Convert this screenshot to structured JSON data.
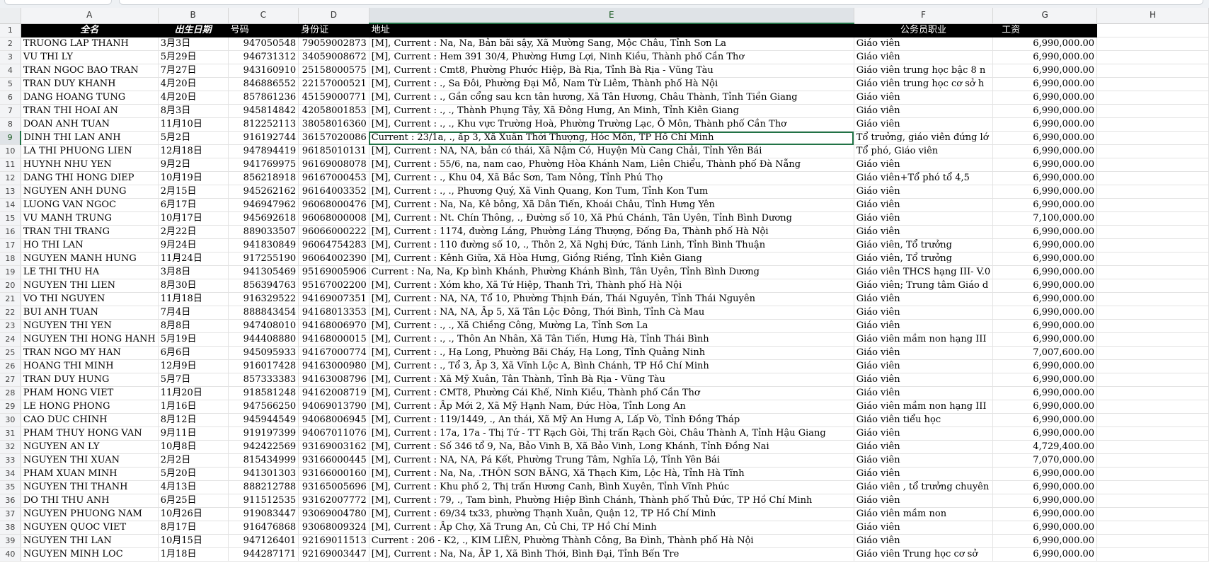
{
  "columns": [
    "A",
    "B",
    "C",
    "D",
    "E",
    "F",
    "G",
    "H"
  ],
  "header": {
    "name": "全名",
    "dob": "出生日期",
    "phone": "号码",
    "id": "身份证",
    "address": "地址",
    "job": "公务员职业",
    "salary": "工资"
  },
  "rows": [
    {
      "n": "2",
      "name": "TRUONG LAP THANH",
      "dob": "3月3日",
      "phone": "947050548",
      "id": "79059002873",
      "address": "[M], Current : Na, Na, Bản bãi sậy, Xã Mường Sang, Mộc Châu, Tỉnh Sơn La",
      "job": "Giáo viên",
      "salary": "6,990,000.00"
    },
    {
      "n": "3",
      "name": "VU THI LY",
      "dob": "5月29日",
      "phone": "946731312",
      "id": "34059008672",
      "address": "[M], Current : Hem 391 30/4, Phường Hưng Lợi, Ninh Kiều, Thành phố Cần Thơ",
      "job": "Giáo viên",
      "salary": "6,990,000.00"
    },
    {
      "n": "4",
      "name": "TRAN NGOC BAO TRAN",
      "dob": "7月27日",
      "phone": "943160910",
      "id": "25158000575",
      "address": "[M], Current : Cmt8, Phường Phước Hiệp, Bà Rịa, Tỉnh Bà Rịa - Vũng Tàu",
      "job": "Giáo viên trung học bậc 8 n",
      "salary": "6,990,000.00"
    },
    {
      "n": "5",
      "name": "TRAN DUY KHANH",
      "dob": "4月20日",
      "phone": "846886552",
      "id": "22157000521",
      "address": "[M], Current : ., Sa Đôi, Phường Đại Mỗ, Nam Từ Liêm, Thành phố Hà Nội",
      "job": "Giáo viên trung học cơ sở h",
      "salary": "6,990,000.00"
    },
    {
      "n": "6",
      "name": "DANG HOANG TUNG",
      "dob": "4月20日",
      "phone": "857861236",
      "id": "45159000771",
      "address": "[M], Current : ., Gần cổng sau kcn tân hương, Xã Tân Hương, Châu Thành, Tỉnh Tiền Giang",
      "job": "Giáo viên",
      "salary": "6,990,000.00"
    },
    {
      "n": "7",
      "name": "TRAN THI HOAI AN",
      "dob": "8月3日",
      "phone": "945814842",
      "id": "42058001853",
      "address": "[M], Current : ., ., Thành Phụng Tây, Xã Đông Hưng, An Minh, Tỉnh Kiên Giang",
      "job": "Giáo viên",
      "salary": "6,990,000.00"
    },
    {
      "n": "8",
      "name": "DOAN ANH TUAN",
      "dob": "11月10日",
      "phone": "812252113",
      "id": "38058016360",
      "address": "[M], Current : ., ., Khu vực Trường Hoà, Phường Trường Lạc, Ô Môn, Thành phố Cần Thơ",
      "job": "Giáo viên",
      "salary": "6,990,000.00"
    },
    {
      "n": "9",
      "name": "DINH THI LAN ANH",
      "dob": "5月2日",
      "phone": "916192744",
      "id": "36157020086",
      "address": "Current : 23/1a, ., ấp 3, Xã Xuân Thới Thượng, Hóc Môn, TP Hồ Chí Minh",
      "job": "Tổ trưởng, giáo viên đứng lớ",
      "salary": "6,990,000.00"
    },
    {
      "n": "10",
      "name": "LA THI PHUONG LIEN",
      "dob": "12月18日",
      "phone": "947894419",
      "id": "96185010131",
      "address": "[M], Current : NA, NA, bản có thái, Xã Nậm Có, Huyện Mù Cang Chải, Tỉnh Yên Bái",
      "job": "Tổ phó, Giáo viên",
      "salary": "6,990,000.00"
    },
    {
      "n": "11",
      "name": "HUYNH NHU YEN",
      "dob": "9月2日",
      "phone": "941769975",
      "id": "96169008078",
      "address": "[M], Current : 55/6, na, nam cao, Phường Hòa Khánh Nam, Liên Chiểu, Thành phố Đà Nẵng",
      "job": "Giáo viên",
      "salary": "6,990,000.00"
    },
    {
      "n": "12",
      "name": "DANG THI HONG DIEP",
      "dob": "10月19日",
      "phone": "856218918",
      "id": "96167000453",
      "address": "[M], Current : ., Khu 04, Xã Bắc Sơn, Tam Nông, Tỉnh Phú Thọ",
      "job": "Giáo viên+Tổ phó tổ 4,5",
      "salary": "6,990,000.00"
    },
    {
      "n": "13",
      "name": "NGUYEN ANH DUNG",
      "dob": "2月15日",
      "phone": "945262162",
      "id": "96164003352",
      "address": "[M], Current : ., ., Phương Quý, Xã Vinh Quang, Kon Tum, Tỉnh Kon Tum",
      "job": "Giáo viên",
      "salary": "6,990,000.00"
    },
    {
      "n": "14",
      "name": "LUONG VAN NGOC",
      "dob": "6月17日",
      "phone": "946947962",
      "id": "96068000476",
      "address": "[M], Current : Na, Na, Kê bông, Xã Dân Tiến, Khoái Châu, Tỉnh Hưng Yên",
      "job": "Giáo viên",
      "salary": "6,990,000.00"
    },
    {
      "n": "15",
      "name": "VU MANH TRUNG",
      "dob": "10月17日",
      "phone": "945692618",
      "id": "96068000008",
      "address": "[M], Current : Nt. Chín Thông, ., Đường số 10, Xã Phú Chánh, Tân Uyên, Tỉnh Bình Dương",
      "job": "Giáo viên",
      "salary": "7,100,000.00"
    },
    {
      "n": "16",
      "name": "TRAN THI TRANG",
      "dob": "2月22日",
      "phone": "889033507",
      "id": "96066000222",
      "address": "[M], Current : 1174, đường Láng, Phường Láng Thượng, Đống Đa, Thành phố Hà Nội",
      "job": "Giáo viên",
      "salary": "6,990,000.00"
    },
    {
      "n": "17",
      "name": "HO THI LAN",
      "dob": "9月24日",
      "phone": "941830849",
      "id": "96064754283",
      "address": "[M], Current : 110 đường  số  10, ., Thôn  2, Xã Nghị Đức, Tánh Linh, Tỉnh Bình Thuận",
      "job": "Giáo viên, Tổ trưởng",
      "salary": "6,990,000.00"
    },
    {
      "n": "18",
      "name": "NGUYEN MANH HUNG",
      "dob": "11月24日",
      "phone": "917255190",
      "id": "96064002390",
      "address": "[M], Current : Kênh Giữa, Xã Hòa Hưng, Giồng Riềng, Tỉnh Kiên Giang",
      "job": "Giáo viên, Tổ trưởng",
      "salary": "6,990,000.00"
    },
    {
      "n": "19",
      "name": "LE THI THU HA",
      "dob": "3月8日",
      "phone": "941305469",
      "id": "95169005906",
      "address": "Current : Na, Na, Kp bình Khánh, Phường Khánh Bình, Tân Uyên, Tỉnh Bình Dương",
      "job": "Giáo viên THCS hạng III- V.0",
      "salary": "6,990,000.00"
    },
    {
      "n": "20",
      "name": "NGUYEN THI LIEN",
      "dob": "8月30日",
      "phone": "856394763",
      "id": "95167002200",
      "address": "[M], Current : Xóm kho, Xã Tứ Hiệp, Thanh Trì, Thành phố Hà Nội",
      "job": "Giáo viên; Trung tâm Giáo d",
      "salary": "6,990,000.00"
    },
    {
      "n": "21",
      "name": "VO THI NGUYEN",
      "dob": "11月18日",
      "phone": "916329522",
      "id": "94169007351",
      "address": "[M], Current : NA, NA, Tổ 10, Phường Thịnh Đán, Thái Nguyên, Tỉnh Thái Nguyên",
      "job": "Giáo viên",
      "salary": "6,990,000.00"
    },
    {
      "n": "22",
      "name": "BUI ANH TUAN",
      "dob": "7月4日",
      "phone": "888843454",
      "id": "94168013353",
      "address": "[M], Current : NA, NA, Ấp 5, Xã Tân Lộc Đông, Thới Bình, Tỉnh Cà Mau",
      "job": "Giáo viên",
      "salary": "6,990,000.00"
    },
    {
      "n": "23",
      "name": "NGUYEN THI YEN",
      "dob": "8月8日",
      "phone": "947408010",
      "id": "94168006970",
      "address": "[M], Current : ., ., Xã Chiềng Công, Mường La, Tỉnh Sơn La",
      "job": "Giáo viên",
      "salary": "6,990,000.00"
    },
    {
      "n": "24",
      "name": "NGUYEN THI HONG HANH",
      "dob": "5月19日",
      "phone": "944408880",
      "id": "94168000015",
      "address": "[M], Current : ., ., Thôn An Nhân, Xã Tân Tiến, Hưng Hà, Tỉnh Thái Bình",
      "job": "Giáo viên mầm non hạng III",
      "salary": "6,990,000.00"
    },
    {
      "n": "25",
      "name": "TRAN NGO MY HAN",
      "dob": "6月6日",
      "phone": "945095933",
      "id": "94167000774",
      "address": "[M], Current : ., Hạ Long, Phường Bãi Cháy, Hạ Long, Tỉnh Quảng Ninh",
      "job": "Giáo viên",
      "salary": "7,007,600.00"
    },
    {
      "n": "26",
      "name": "HOANG THI MINH",
      "dob": "12月9日",
      "phone": "916017428",
      "id": "94163000980",
      "address": "[M], Current : ., Tổ 3, Ấp 3, Xã Vĩnh Lộc A, Bình Chánh, TP Hồ Chí Minh",
      "job": "Giáo viên",
      "salary": "6,990,000.00"
    },
    {
      "n": "27",
      "name": "TRAN DUY HUNG",
      "dob": "5月7日",
      "phone": "857333383",
      "id": "94163008796",
      "address": "[M], Current : Xã Mỹ Xuân, Tân Thành, Tỉnh Bà Rịa - Vũng Tàu",
      "job": "Giáo viên",
      "salary": "6,990,000.00"
    },
    {
      "n": "28",
      "name": "PHAM HONG VIET",
      "dob": "11月20日",
      "phone": "918581248",
      "id": "94162008719",
      "address": "[M], Current : CMT8, Phường Cái Khế, Ninh Kiều, Thành phố Cần Thơ",
      "job": "Giáo viên",
      "salary": "6,990,000.00"
    },
    {
      "n": "29",
      "name": "LE HONG PHONG",
      "dob": "1月16日",
      "phone": "947566250",
      "id": "94069013790",
      "address": "[M], Current : Ấp Mới 2, Xã Mỹ Hạnh Nam, Đức Hòa, Tỉnh Long An",
      "job": "Giáo viên mầm non hạng III",
      "salary": "6,990,000.00"
    },
    {
      "n": "30",
      "name": "CAO DUC CHINH",
      "dob": "8月12日",
      "phone": "945944549",
      "id": "94068006945",
      "address": "[M], Current : 119/1449, ., An thái, Xã Mỹ An Hưng A, Lấp Vò, Tỉnh Đồng Tháp",
      "job": "Giáo viên tiểu học",
      "salary": "6,990,000.00"
    },
    {
      "n": "31",
      "name": "PHAM THUY HONG VAN",
      "dob": "9月11日",
      "phone": "919197399",
      "id": "94067011076",
      "address": "[M], Current : 17a, 17a - Thị Tứ - TT Rạch Gòi, Thị trấn Rạch Gòi, Châu Thành A, Tỉnh Hậu Giang",
      "job": "Giáo viên",
      "salary": "6,990,000.00"
    },
    {
      "n": "32",
      "name": "NGUYEN AN LY",
      "dob": "10月8日",
      "phone": "942422569",
      "id": "93169003162",
      "address": "[M], Current : Số 346 tổ 9, Na, Bảo Vinh B, Xã Bảo Vinh, Long Khánh, Tỉnh Đồng Nai",
      "job": "Giáo viên",
      "salary": "4,729,400.00"
    },
    {
      "n": "33",
      "name": "NGUYEN THI XUAN",
      "dob": "2月2日",
      "phone": "815434999",
      "id": "93166000445",
      "address": "[M], Current : NA, NA, Pá Kết, Phường Trung Tâm, Nghĩa Lộ, Tỉnh Yên Bái",
      "job": "Giáo viên",
      "salary": "7,070,000.00"
    },
    {
      "n": "34",
      "name": "PHAM XUAN MINH",
      "dob": "5月20日",
      "phone": "941301303",
      "id": "93166000160",
      "address": "[M], Current : Na, Na, .THÔN SƠN BẰNG, Xã Thạch Kim, Lộc Hà, Tỉnh Hà Tĩnh",
      "job": "Giáo viên",
      "salary": "6,990,000.00"
    },
    {
      "n": "35",
      "name": "NGUYEN THI THANH",
      "dob": "4月13日",
      "phone": "888212788",
      "id": "93165005696",
      "address": "[M], Current : Khu phố 2, Thị trấn Hương Canh, Bình Xuyên, Tỉnh Vĩnh Phúc",
      "job": "Giáo viên , tổ trưởng chuyên",
      "salary": "6,990,000.00"
    },
    {
      "n": "36",
      "name": "DO THI THU ANH",
      "dob": "6月25日",
      "phone": "911512535",
      "id": "93162007772",
      "address": "[M], Current : 79, ., Tam bình, Phường Hiệp Bình Chánh, Thành phố Thủ Đức, TP Hồ Chí Minh",
      "job": "Giáo viên",
      "salary": "6,990,000.00"
    },
    {
      "n": "37",
      "name": "NGUYEN PHUONG NAM",
      "dob": "10月26日",
      "phone": "919083447",
      "id": "93069004780",
      "address": "[M], Current : 69/34 tx33, phường Thạnh Xuân, Quận 12, TP Hồ Chí Minh",
      "job": "Giáo viên mầm non",
      "salary": "6,990,000.00"
    },
    {
      "n": "38",
      "name": "NGUYEN QUOC VIET",
      "dob": "8月17日",
      "phone": "916476868",
      "id": "93068009324",
      "address": "[M], Current : Ấp Chợ, Xã Trung An, Củ Chi, TP Hồ Chí Minh",
      "job": "Giáo viên",
      "salary": "6,990,000.00"
    },
    {
      "n": "39",
      "name": "NGUYEN THI LAN",
      "dob": "10月15日",
      "phone": "947126401",
      "id": "92169011513",
      "address": "Current : 206 - K2, ., KIM LIÊN, Phường Thành Công, Ba Đình, Thành phố Hà Nội",
      "job": "Giáo viên",
      "salary": "6,990,000.00"
    },
    {
      "n": "40",
      "name": "NGUYEN MINH LOC",
      "dob": "1月18日",
      "phone": "944287171",
      "id": "92169003447",
      "address": "[M], Current : Na, Na, ẤP 1, Xã Bình Thới, Bình Đại, Tỉnh Bến Tre",
      "job": "Giáo viên Trung học cơ sở",
      "salary": "6,990,000.00"
    }
  ]
}
